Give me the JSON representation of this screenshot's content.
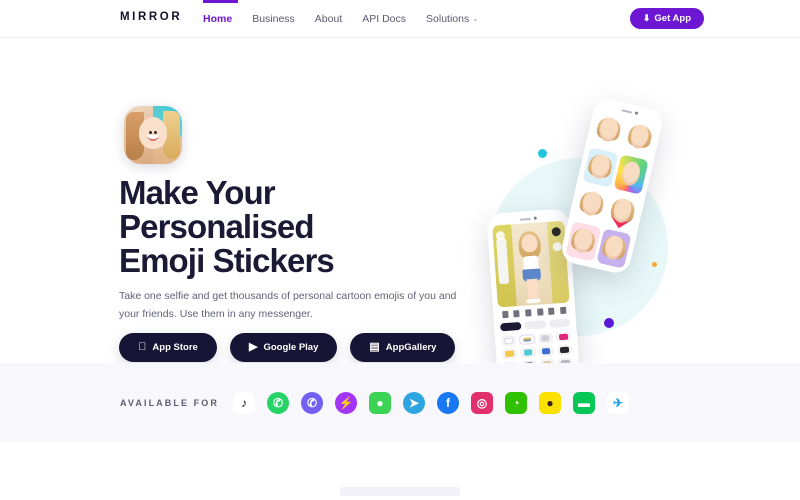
{
  "header": {
    "logo": "MIRROR",
    "nav": [
      {
        "label": "Home",
        "active": true
      },
      {
        "label": "Business",
        "active": false
      },
      {
        "label": "About",
        "active": false
      },
      {
        "label": "API Docs",
        "active": false
      },
      {
        "label": "Solutions",
        "active": false,
        "caret": "⌄"
      }
    ],
    "cta": {
      "label": "Get App",
      "icon": "⬇",
      "icon_name": "download-icon",
      "color": "#6d16d4"
    }
  },
  "hero": {
    "app_icon_name": "mirror-app-icon",
    "headline": "Make Your\nPersonalised\nEmoji Stickers",
    "headline_lines": [
      "Make Your",
      "Personalised",
      "Emoji Stickers"
    ],
    "subhead": "Take one selfie and get thousands of personal cartoon emojis of you and your friends. Use them in any messenger.",
    "store_buttons": [
      {
        "label": "App Store",
        "icon": "",
        "icon_name": "apple-icon"
      },
      {
        "label": "Google Play",
        "icon": "▶",
        "icon_name": "google-play-icon"
      },
      {
        "label": "AppGallery",
        "icon": "▤",
        "icon_name": "appgallery-icon"
      }
    ],
    "artwork": {
      "name": "phone-mockups",
      "circle_color": "#e8f8f9",
      "dots": [
        "#22c5dd",
        "#5b18d6",
        "#f7a834",
        "#f7a834"
      ]
    }
  },
  "available": {
    "label": "AVAILABLE FOR",
    "apps": [
      {
        "name": "tiktok",
        "glyph": "♪",
        "bg": "#ffffff",
        "fg": "#11111f",
        "round": false
      },
      {
        "name": "whatsapp",
        "glyph": "✆",
        "bg": "#25d366",
        "fg": "#ffffff",
        "round": true
      },
      {
        "name": "viber",
        "glyph": "✆",
        "bg": "#7360f2",
        "fg": "#ffffff",
        "round": true
      },
      {
        "name": "messenger",
        "glyph": "⚡",
        "bg": "#a334fa",
        "fg": "#ffffff",
        "round": true
      },
      {
        "name": "imessage",
        "glyph": "●",
        "bg": "#3ad353",
        "fg": "#ffffff",
        "round": false
      },
      {
        "name": "telegram",
        "glyph": "➤",
        "bg": "#2ca5e0",
        "fg": "#ffffff",
        "round": true
      },
      {
        "name": "facebook",
        "glyph": "f",
        "bg": "#1877f2",
        "fg": "#ffffff",
        "round": true
      },
      {
        "name": "instagram",
        "glyph": "◎",
        "bg": "#e1306c",
        "fg": "#ffffff",
        "round": false
      },
      {
        "name": "wechat",
        "glyph": "◔",
        "bg": "#2dc100",
        "fg": "#ffffff",
        "round": false
      },
      {
        "name": "kakaotalk",
        "glyph": "●",
        "bg": "#fae100",
        "fg": "#3c1e1e",
        "round": false
      },
      {
        "name": "line",
        "glyph": "▬",
        "bg": "#06c755",
        "fg": "#ffffff",
        "round": false
      },
      {
        "name": "twitter",
        "glyph": "✈",
        "bg": "#ffffff",
        "fg": "#1da1f2",
        "round": false
      }
    ]
  }
}
